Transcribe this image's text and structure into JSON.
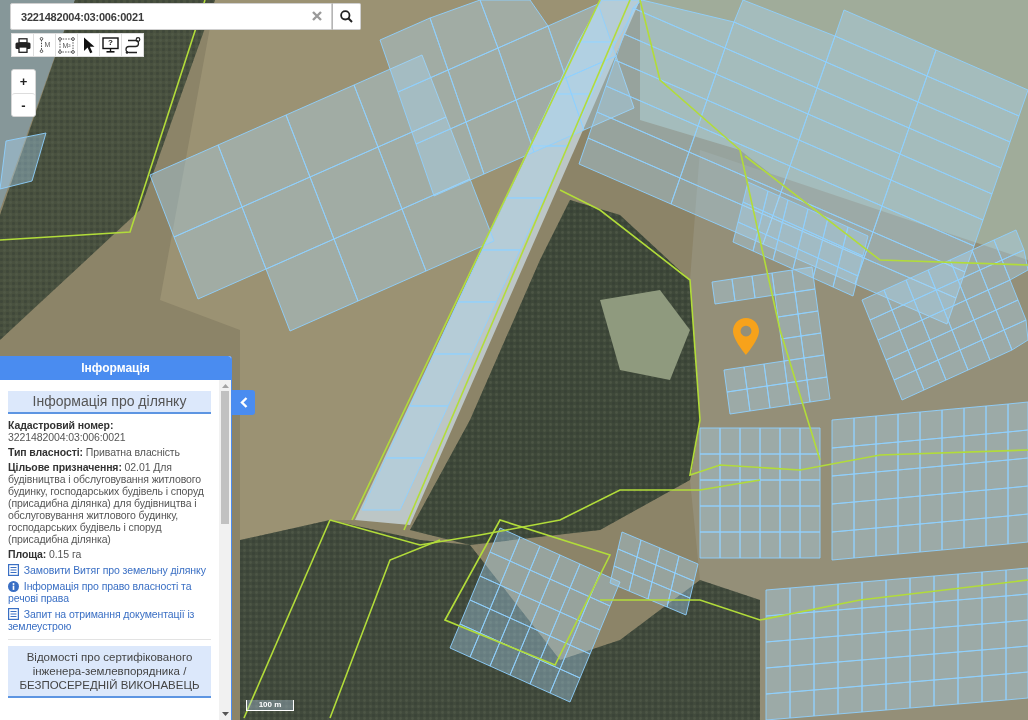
{
  "search": {
    "value": "3221482004:03:006:0021"
  },
  "toolbar": [
    {
      "kind": "print"
    },
    {
      "kind": "measure-distance",
      "label": "M"
    },
    {
      "kind": "measure-area",
      "label": "M²"
    },
    {
      "kind": "select"
    },
    {
      "kind": "help",
      "label": "?"
    },
    {
      "kind": "route"
    }
  ],
  "zoom": [
    "+",
    "-"
  ],
  "panel": {
    "title": "Інформація",
    "section_title": "Інформація про ділянку",
    "fields": [
      {
        "label": "Кадастровий номер:",
        "value": "3221482004:03:006:0021"
      },
      {
        "label": "Тип власності:",
        "value": "Приватна власність"
      },
      {
        "label": "Цільове призначення:",
        "value": "02.01 Для будівництва і обслуговування житлового будинку, господарських будівель і споруд (присадибна ділянка) для будівництва і обслуговування житлового будинку, господарських будівель і споруд (присадибна ділянка)"
      },
      {
        "label": "Площа:",
        "value": "0.15 га"
      }
    ],
    "links": [
      {
        "kind": "document",
        "text": "Замовити Витяг про земельну ділянку"
      },
      {
        "kind": "info",
        "text": "Інформація про право власності та речові права"
      },
      {
        "kind": "document",
        "text": "Запит на отримання документації із землеустрою"
      }
    ],
    "section2_title": "Відомості про сертифікованого інженера-землевпорядника / БЕЗПОСЕРЕДНІЙ ВИКОНАВЕЦЬ"
  },
  "map": {
    "scale": "100 m"
  }
}
